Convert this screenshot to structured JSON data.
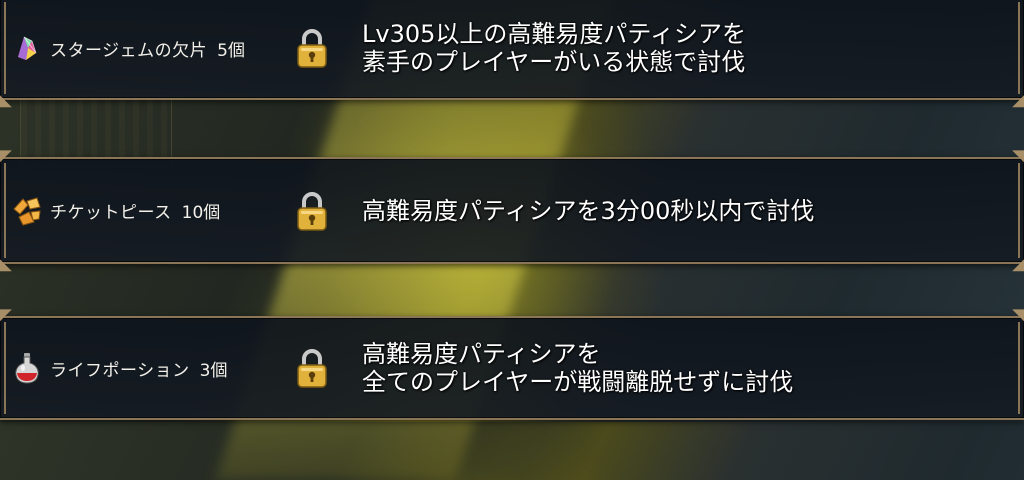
{
  "missions": [
    {
      "reward_icon": "star-gem-fragment-icon",
      "reward_name": "スタージェムの欠片",
      "reward_qty": "5個",
      "locked": true,
      "condition_lines": [
        "Lv305以上の高難易度パティシアを",
        "素手のプレイヤーがいる状態で討伐"
      ]
    },
    {
      "reward_icon": "ticket-piece-icon",
      "reward_name": "チケットピース",
      "reward_qty": "10個",
      "locked": true,
      "condition_lines": [
        "高難易度パティシアを3分00秒以内で討伐",
        ""
      ]
    },
    {
      "reward_icon": "life-potion-icon",
      "reward_name": "ライフポーション",
      "reward_qty": "3個",
      "locked": true,
      "condition_lines": [
        "高難易度パティシアを",
        "全てのプレイヤーが戦闘離脱せずに討伐"
      ]
    }
  ],
  "colors": {
    "frame": "#8a7556",
    "lock_gold": "#e0b23c",
    "text": "#ffffff"
  }
}
